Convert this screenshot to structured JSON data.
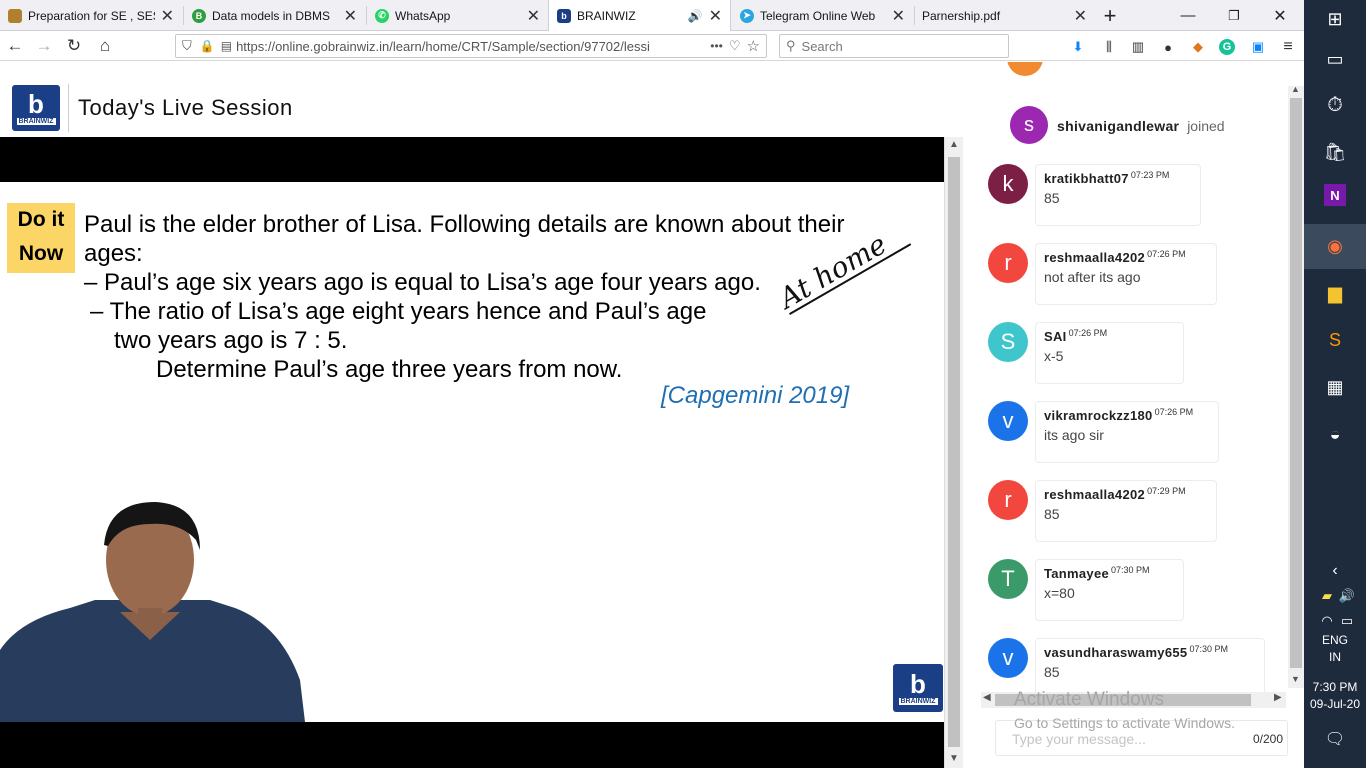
{
  "browser": {
    "tabs": [
      {
        "title": "Preparation for SE , SES",
        "color": "#b08030"
      },
      {
        "title": "Data models in DBMS",
        "color": "#2e9e3e"
      },
      {
        "title": "WhatsApp",
        "color": "#25d366"
      },
      {
        "title": "BRAINWIZ",
        "color": "#1b3f86"
      },
      {
        "title": "Telegram Online Web",
        "color": "#2ca5e0"
      },
      {
        "title": "Parnership.pdf",
        "color": ""
      }
    ],
    "url": "https://online.gobrainwiz.in/learn/home/CRT/Sample/section/97702/lessi",
    "url_more": "•••",
    "search_placeholder": "Search"
  },
  "site": {
    "title": "Today's Live Session",
    "logo_text": "BRAINWIZ",
    "logo_letter": "b"
  },
  "slide": {
    "badge_line1": "Do it",
    "badge_line2": "Now",
    "q_line1": "Paul is the elder brother of Lisa. Following details are known about their",
    "q_line2": "ages:",
    "q_line3": "– Paul’s age six years ago is equal to Lisa’s age four years ago.",
    "q_line4": "– The ratio of Lisa’s age eight years hence and Paul’s age",
    "q_line5": "two years ago is 7 : 5.",
    "q_line6": "Determine Paul’s age three years from now.",
    "citation": "[Capgemini 2019]",
    "handwriting": "At home"
  },
  "chat": {
    "join_notice": {
      "initial": "s",
      "user": "shivanigandlewar",
      "action": "joined",
      "color": "#9c27b0"
    },
    "messages": [
      {
        "initial": "k",
        "user": "kratikbhatt07",
        "time": "07:23 PM",
        "text": "85",
        "color": "#7b1f45"
      },
      {
        "initial": "r",
        "user": "reshmaalla4202",
        "time": "07:26 PM",
        "text": "not after its ago",
        "color": "#f2473f"
      },
      {
        "initial": "S",
        "user": "SAI",
        "time": "07:26 PM",
        "text": "x-5",
        "color": "#3ec6cc"
      },
      {
        "initial": "v",
        "user": "vikramrockzz180",
        "time": "07:26 PM",
        "text": "its ago sir",
        "color": "#1a73e8"
      },
      {
        "initial": "r",
        "user": "reshmaalla4202",
        "time": "07:29 PM",
        "text": "85",
        "color": "#f2473f"
      },
      {
        "initial": "T",
        "user": "Tanmayee",
        "time": "07:30 PM",
        "text": "x=80",
        "color": "#3a9a6a"
      },
      {
        "initial": "v",
        "user": "vasundharaswamy655",
        "time": "07:30 PM",
        "text": "85",
        "color": "#1a73e8"
      }
    ],
    "input_placeholder": "Type your message...",
    "char_count": "0/200"
  },
  "watermark": {
    "line1": "Activate Windows",
    "line2": "Go to Settings to activate Windows."
  },
  "taskbar": {
    "lang1": "ENG",
    "lang2": "IN",
    "time": "7:30 PM",
    "date": "09-Jul-20"
  }
}
